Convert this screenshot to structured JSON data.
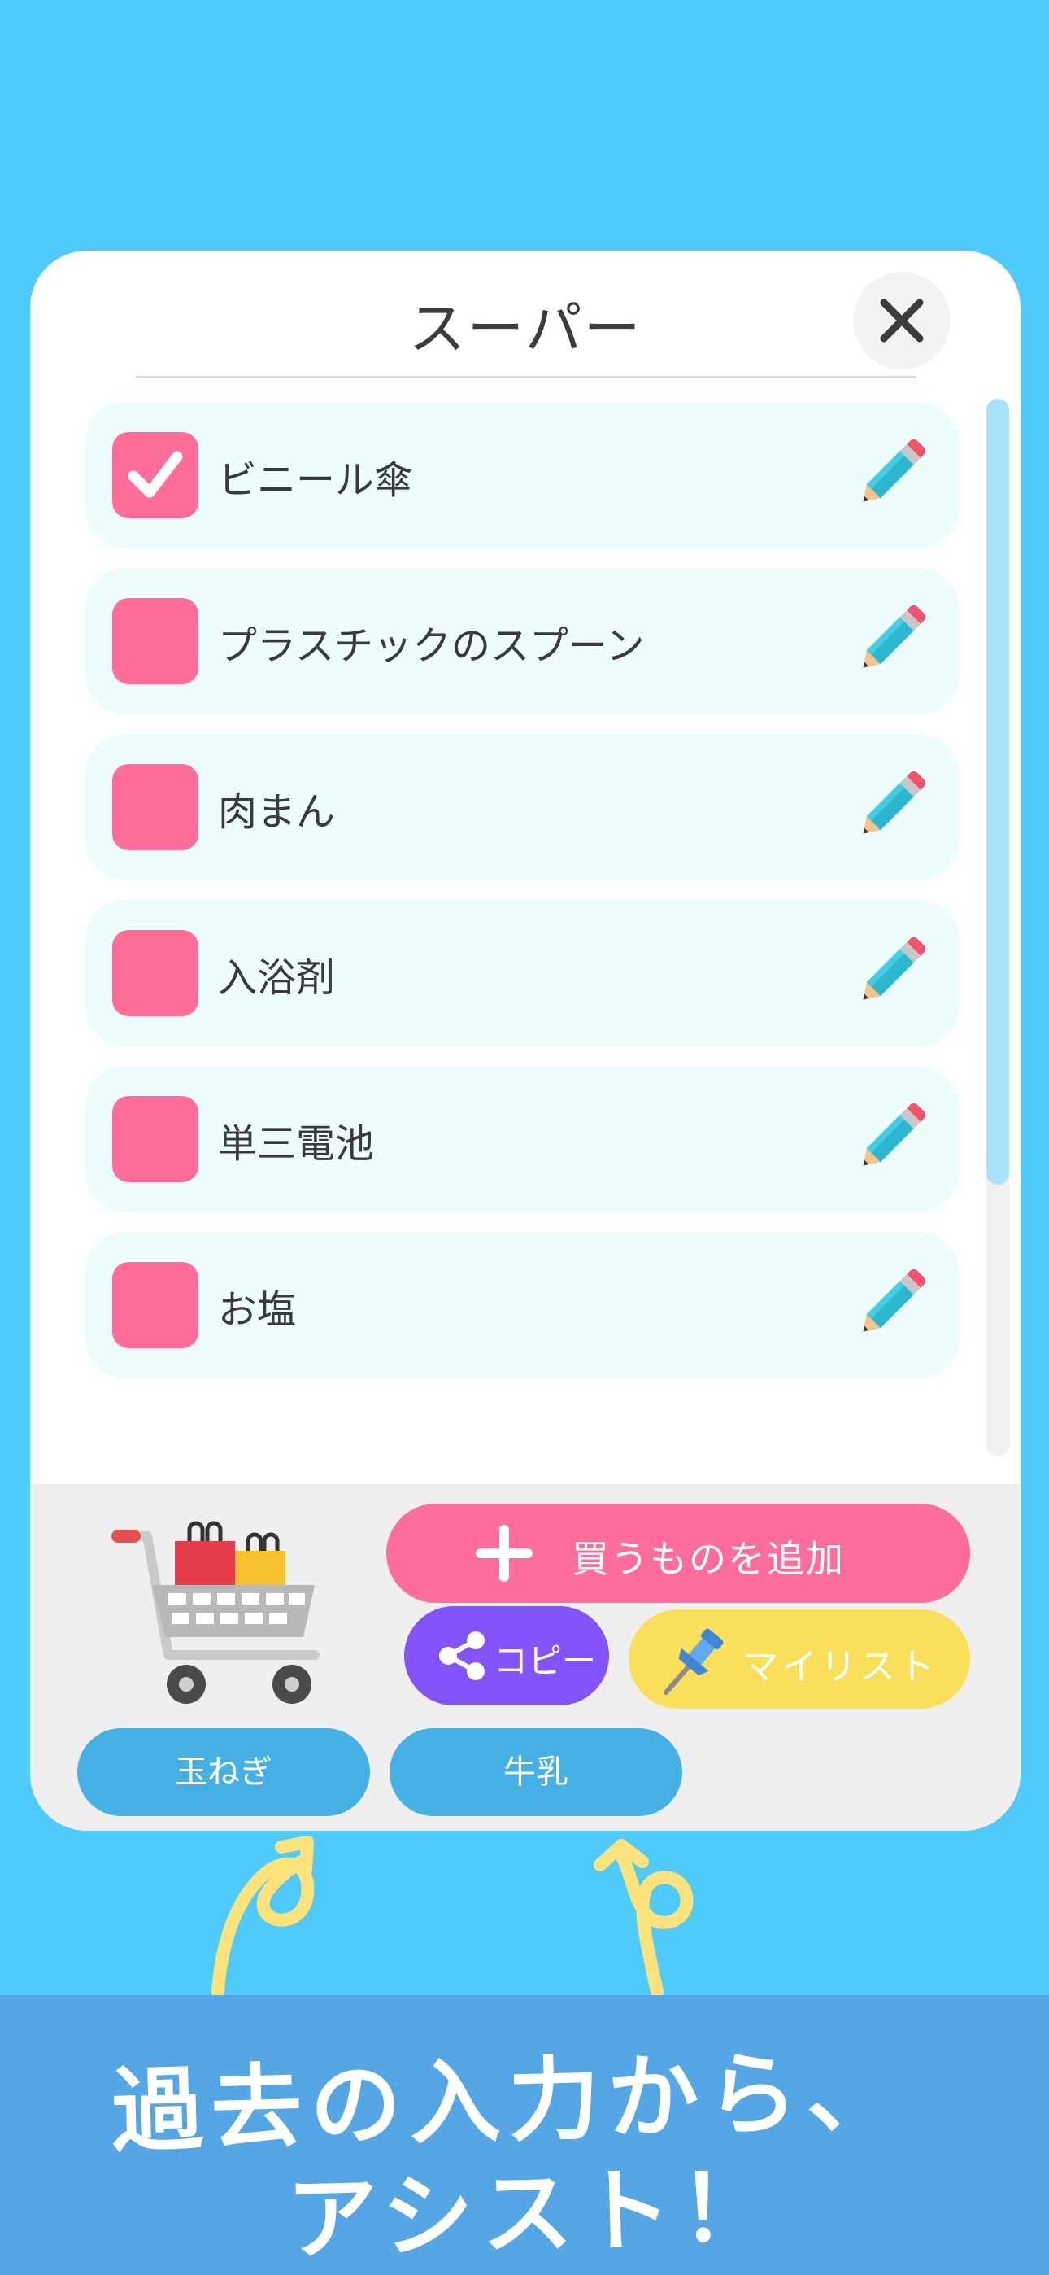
{
  "card": {
    "title": "スーパー"
  },
  "items": [
    {
      "label": "ビニール傘",
      "checked": true
    },
    {
      "label": "プラスチックのスプーン",
      "checked": false
    },
    {
      "label": "肉まん",
      "checked": false
    },
    {
      "label": "入浴剤",
      "checked": false
    },
    {
      "label": "単三電池",
      "checked": false
    },
    {
      "label": "お塩",
      "checked": false
    }
  ],
  "actions": {
    "add_label": "買うものを追加",
    "copy_label": "コピー",
    "mylist_label": "マイリスト"
  },
  "suggestions": [
    "玉ねぎ",
    "牛乳"
  ],
  "banner": {
    "line1": "過去の入力から、",
    "line2": "アシスト！"
  },
  "colors": {
    "background": "#4ecbfb",
    "checkbox": "#ff6e9a",
    "add_button": "#ff6d9c",
    "copy_button": "#8253f8",
    "mylist_button": "#f9df5a",
    "suggestion_chip": "#45b0e3",
    "banner": "#55a6e5",
    "arrow": "#fbe27a"
  },
  "icons": {
    "close": "close-icon",
    "edit": "pencil-icon",
    "check": "checkmark-icon",
    "add": "plus-icon",
    "copy": "share-icon",
    "mylist": "pushpin-icon",
    "cart": "shopping-cart-icon"
  }
}
